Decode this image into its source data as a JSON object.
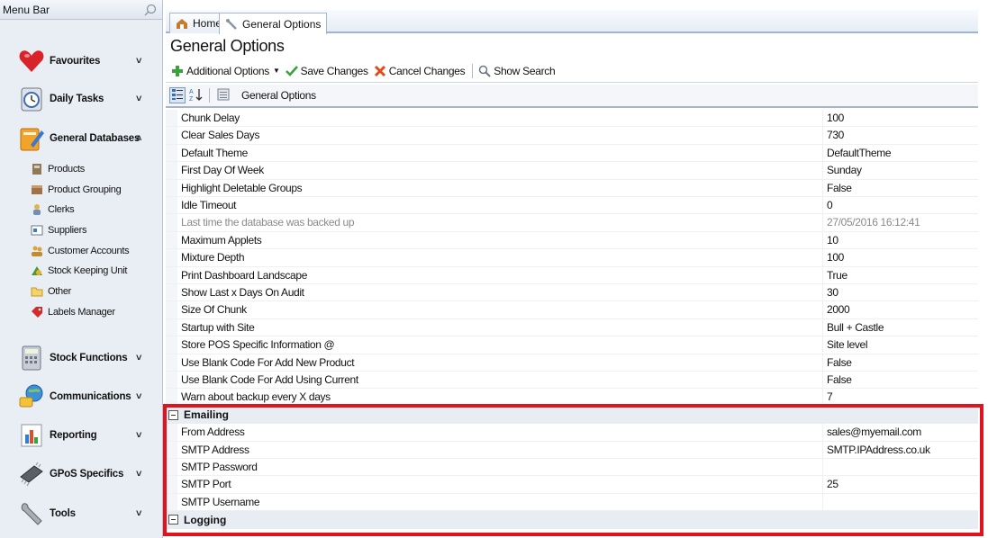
{
  "sidebar": {
    "title": "Menu Bar",
    "groups": [
      {
        "label": "Favourites",
        "icon": "heart-icon",
        "chevron": "˅"
      },
      {
        "label": "Daily Tasks",
        "icon": "clock-icon",
        "chevron": "˅"
      },
      {
        "label": "General Databases",
        "icon": "database-icon",
        "chevron": "˄"
      },
      {
        "label": "Stock Functions",
        "icon": "calculator-icon",
        "chevron": "˅"
      },
      {
        "label": "Communications",
        "icon": "globe-icon",
        "chevron": "˅"
      },
      {
        "label": "Reporting",
        "icon": "bar-chart-icon",
        "chevron": "˅"
      },
      {
        "label": "GPoS Specifics",
        "icon": "chip-icon",
        "chevron": "˅"
      },
      {
        "label": "Tools",
        "icon": "wrench-icon",
        "chevron": "˅"
      }
    ],
    "sub_items": [
      {
        "label": "Products",
        "icon": "products-icon"
      },
      {
        "label": "Product Grouping",
        "icon": "grouping-icon"
      },
      {
        "label": "Clerks",
        "icon": "clerk-icon"
      },
      {
        "label": "Suppliers",
        "icon": "supplier-icon"
      },
      {
        "label": "Customer Accounts",
        "icon": "customers-icon"
      },
      {
        "label": "Stock Keeping Unit",
        "icon": "sku-icon"
      },
      {
        "label": "Other",
        "icon": "folder-icon"
      },
      {
        "label": "Labels Manager",
        "icon": "label-icon"
      }
    ]
  },
  "tabs": [
    {
      "label": "Home",
      "icon": "home-icon"
    },
    {
      "label": "General Options",
      "icon": "wrench-icon"
    }
  ],
  "page": {
    "title": "General Options"
  },
  "toolbar": {
    "additional_options": "Additional Options",
    "save_changes": "Save Changes",
    "cancel_changes": "Cancel Changes",
    "show_search": "Show Search"
  },
  "grid": {
    "title": "General Options",
    "rows": [
      {
        "name": "Chunk Delay",
        "value": "100"
      },
      {
        "name": "Clear Sales Days",
        "value": "730"
      },
      {
        "name": "Default Theme",
        "value": "DefaultTheme"
      },
      {
        "name": "First Day Of Week",
        "value": "Sunday"
      },
      {
        "name": "Highlight Deletable Groups",
        "value": "False"
      },
      {
        "name": "Idle Timeout",
        "value": "0"
      },
      {
        "name": "Last time the database was backed up",
        "value": "27/05/2016 16:12:41",
        "readonly": true
      },
      {
        "name": "Maximum Applets",
        "value": "10"
      },
      {
        "name": "Mixture Depth",
        "value": "100"
      },
      {
        "name": "Print Dashboard Landscape",
        "value": "True"
      },
      {
        "name": "Show Last x Days On Audit",
        "value": "30"
      },
      {
        "name": "Size Of Chunk",
        "value": "2000"
      },
      {
        "name": "Startup with Site",
        "value": "Bull + Castle"
      },
      {
        "name": "Store POS Specific Information @",
        "value": "Site level"
      },
      {
        "name": "Use Blank Code For Add New Product",
        "value": "False"
      },
      {
        "name": "Use Blank Code For Add Using Current",
        "value": "False"
      },
      {
        "name": "Warn about backup every X days",
        "value": "7"
      }
    ],
    "emailing": {
      "label": "Emailing",
      "rows": [
        {
          "name": "From Address",
          "value": "sales@myemail.com"
        },
        {
          "name": "SMTP Address",
          "value": "SMTP.IPAddress.co.uk"
        },
        {
          "name": "SMTP Password",
          "value": ""
        },
        {
          "name": "SMTP Port",
          "value": "25"
        },
        {
          "name": "SMTP Username",
          "value": ""
        }
      ]
    },
    "logging": {
      "label": "Logging"
    }
  },
  "colors": {
    "highlight": "#e0141e",
    "accent": "#9db4d6"
  }
}
